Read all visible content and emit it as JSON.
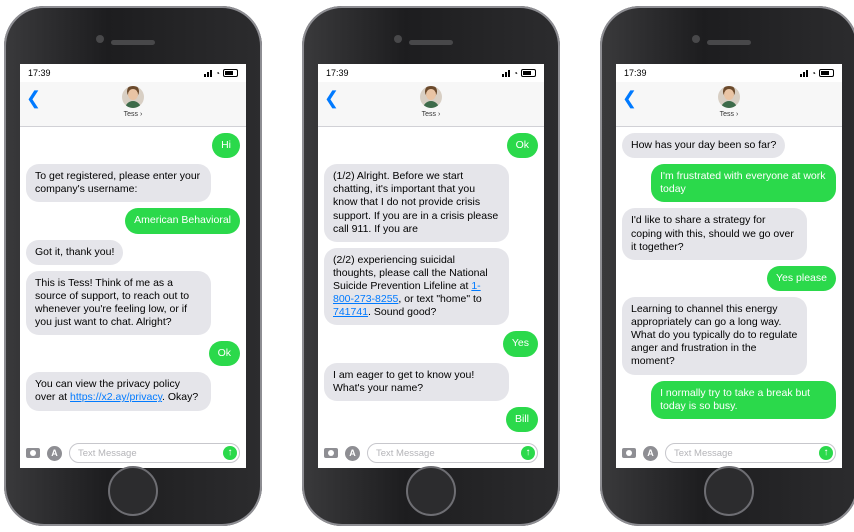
{
  "phones": [
    {
      "time": "17:39",
      "contact": "Tess",
      "messages": [
        {
          "dir": "out",
          "text": "Hi"
        },
        {
          "dir": "in",
          "text": "To get registered, please enter your company's username:"
        },
        {
          "dir": "out",
          "text": "American Behavioral"
        },
        {
          "dir": "in",
          "text": "Got it, thank you!"
        },
        {
          "dir": "in",
          "text": "This is Tess! Think of me as a source of support, to reach out to whenever you're feeling low, or if you just want to chat. Alright?"
        },
        {
          "dir": "out",
          "text": "Ok"
        },
        {
          "dir": "in",
          "parts": [
            "You can view the privacy policy over at ",
            "https://x2.ay/privacy",
            ". Okay?"
          ]
        }
      ]
    },
    {
      "time": "17:39",
      "contact": "Tess",
      "messages": [
        {
          "dir": "out",
          "text": "Ok"
        },
        {
          "dir": "in",
          "text": "(1/2) Alright. Before we start chatting, it's important that you know that I do not provide crisis support. If you are in a crisis please call 911. If you are"
        },
        {
          "dir": "in",
          "parts": [
            "(2/2) experiencing suicidal thoughts, please call the National Suicide Prevention Lifeline at ",
            "1-800-273-8255",
            ", or text \"home\" to ",
            "741741",
            ". Sound good?"
          ]
        },
        {
          "dir": "out",
          "text": "Yes"
        },
        {
          "dir": "in",
          "text": "I am eager to get to know you! What's your name?"
        },
        {
          "dir": "out",
          "text": "Bill"
        }
      ]
    },
    {
      "time": "17:39",
      "contact": "Tess",
      "messages": [
        {
          "dir": "in",
          "text": "How has your day been so far?"
        },
        {
          "dir": "out",
          "text": "I'm frustrated with everyone at work today"
        },
        {
          "dir": "in",
          "text": "I'd like to share a strategy for coping with this, should we go over it together?"
        },
        {
          "dir": "out",
          "text": "Yes please"
        },
        {
          "dir": "in",
          "text": "Learning to channel this energy appropriately can go a long way. What do you typically do to regulate anger and frustration in the moment?"
        },
        {
          "dir": "out",
          "text": "I normally try to take a break but today is so busy."
        }
      ]
    }
  ],
  "input_placeholder": "Text Message",
  "icons": {
    "back": "chevron-left-icon",
    "camera": "camera-icon",
    "apps": "app-store-icon",
    "send": "send-arrow-icon"
  },
  "colors": {
    "outgoing": "#2bd94b",
    "incoming": "#e5e5ea",
    "link": "#007aff"
  }
}
